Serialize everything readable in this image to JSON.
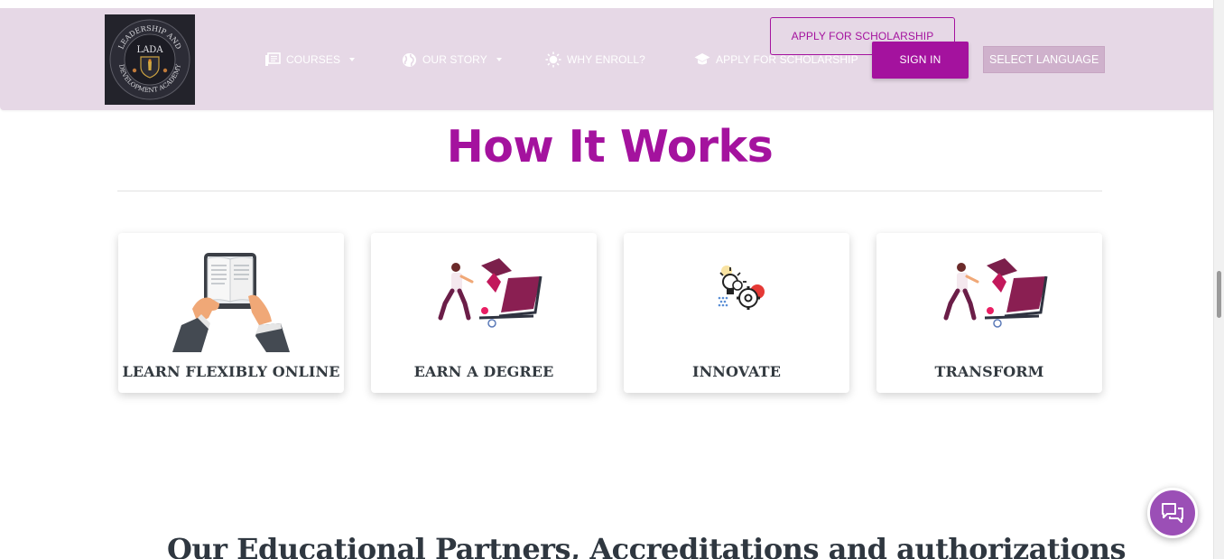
{
  "brand": {
    "logo_arc_top": "LEADERSHIP AND",
    "logo_arc_bottom": "DEVELOPMENT ACADEMY",
    "logo_text": "LADA"
  },
  "nav": {
    "items": [
      {
        "label": "COURSES",
        "icon": "book-icon",
        "dropdown": true
      },
      {
        "label": "OUR STORY",
        "icon": "globe-icon",
        "dropdown": true
      },
      {
        "label": "WHY ENROLL?",
        "icon": "sun-icon",
        "dropdown": false
      },
      {
        "label": "APPLY FOR SCHOLARSHIP",
        "icon": "graduation-cap-icon",
        "dropdown": false
      }
    ],
    "apply_button": "APPLY FOR SCHOLARSHIP",
    "signin_button": "SIGN IN",
    "language_select": "SELECT LANGUAGE"
  },
  "main": {
    "heading": "How It Works",
    "cards": [
      {
        "label": "LEARN FLEXIBLY ONLINE",
        "icon": "tablet-reading-icon"
      },
      {
        "label": "EARN A DEGREE",
        "icon": "graduate-laptop-icon"
      },
      {
        "label": "INNOVATE",
        "icon": "lightbulb-gears-icon"
      },
      {
        "label": "TRANSFORM",
        "icon": "graduate-laptop-icon"
      }
    ],
    "partners_heading": "Our Educational Partners, Accreditations and authorizations"
  },
  "chat": {
    "icon": "chat-bubbles-icon"
  },
  "colors": {
    "brand_purple": "#a4129e",
    "nav_bg": "#e6d8e6",
    "chat_purple": "#9b4fb6",
    "text_dark": "#333a40"
  }
}
